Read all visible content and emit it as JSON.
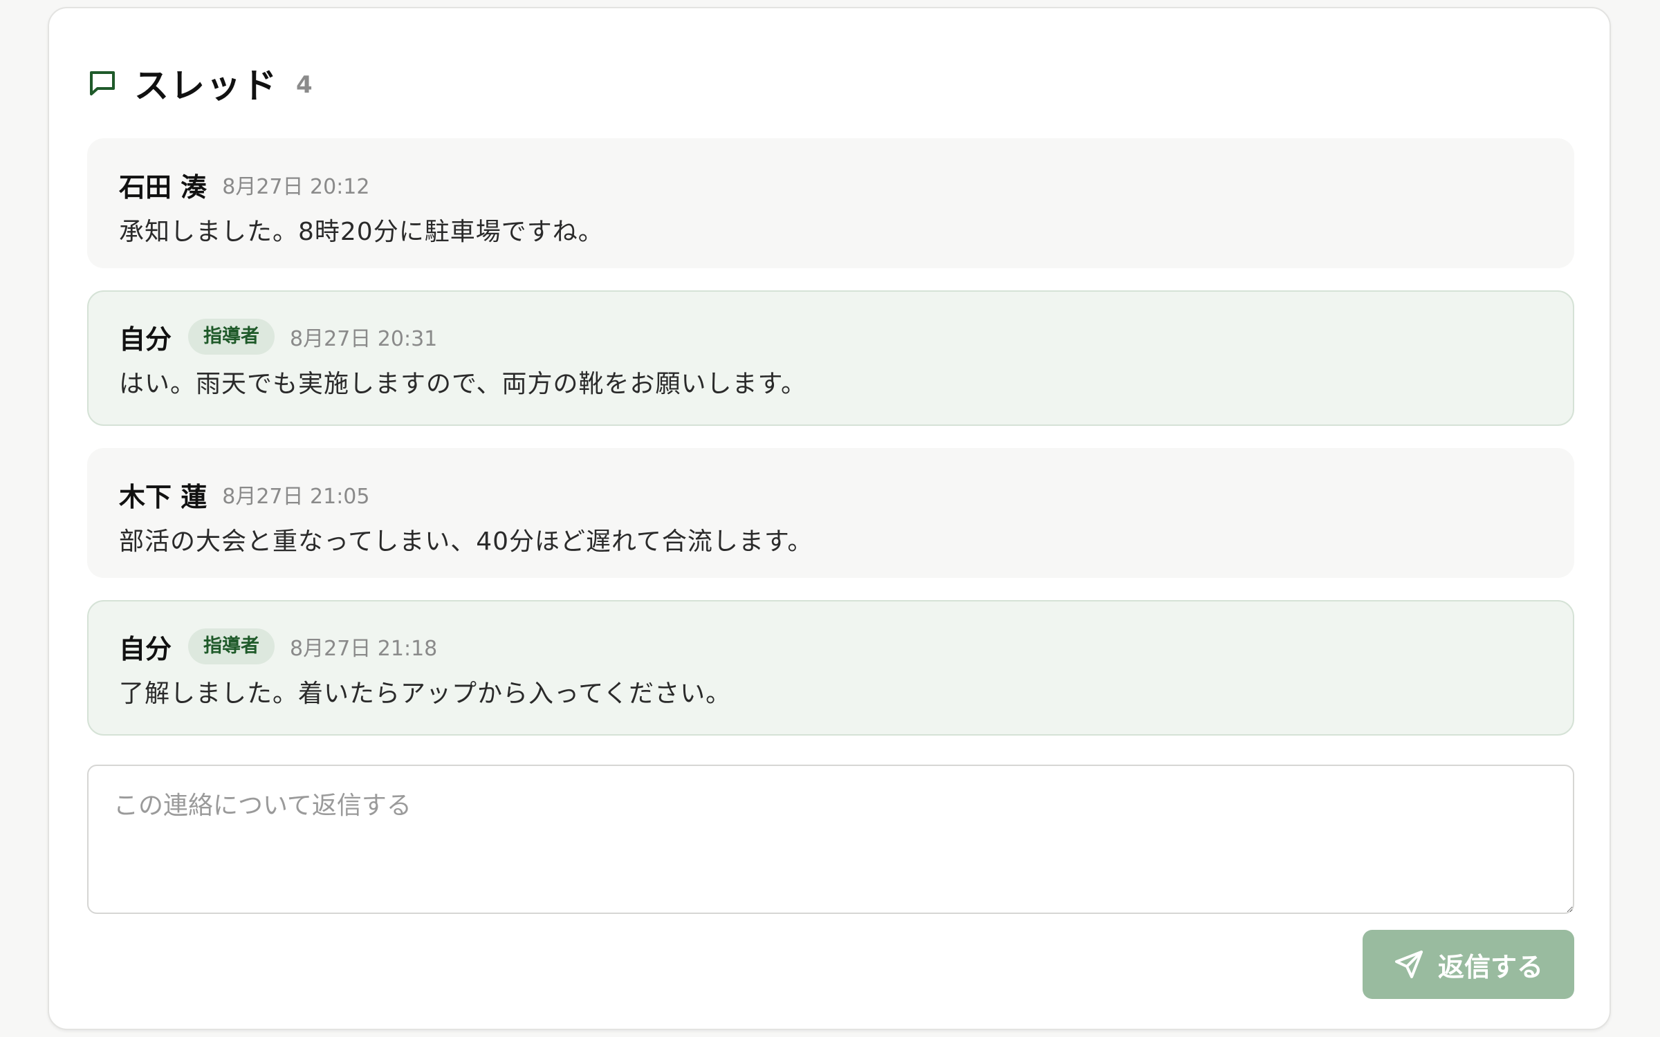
{
  "thread": {
    "title": "スレッド",
    "count": "4",
    "icon": "chat-bubble-icon",
    "accent_color": "#1f5a2a"
  },
  "messages": [
    {
      "author": "石田 湊",
      "role": "",
      "time": "8月27日 20:12",
      "text": "承知しました。8時20分に駐車場ですね。",
      "mine": false
    },
    {
      "author": "自分",
      "role": "指導者",
      "time": "8月27日 20:31",
      "text": "はい。雨天でも実施しますので、両方の靴をお願いします。",
      "mine": true
    },
    {
      "author": "木下 蓮",
      "role": "",
      "time": "8月27日 21:05",
      "text": "部活の大会と重なってしまい、40分ほど遅れて合流します。",
      "mine": false
    },
    {
      "author": "自分",
      "role": "指導者",
      "time": "8月27日 21:18",
      "text": "了解しました。着いたらアップから入ってください。",
      "mine": true
    }
  ],
  "reply": {
    "placeholder": "この連絡について返信する",
    "value": "",
    "button_label": "返信する",
    "button_icon": "send-icon",
    "button_color": "#99bb9f"
  }
}
